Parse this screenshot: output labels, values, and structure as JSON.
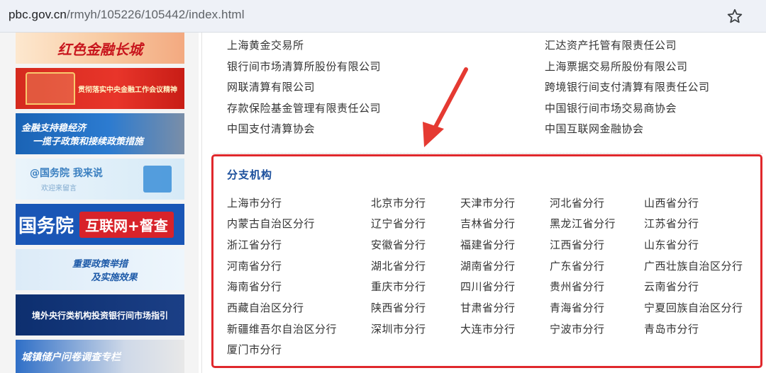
{
  "browser": {
    "url_domain": "pbc.gov.cn",
    "url_path": "/rmyh/105226/105442/index.html",
    "bookmark_icon": "star-icon"
  },
  "sidebar": {
    "banners": [
      {
        "text": "红色金融长城"
      },
      {
        "text": "贯彻落实中央金融工作会议精神"
      },
      {
        "line1": "金融支持稳经济",
        "line2": "一揽子政策和接续政策措施"
      },
      {
        "line1": "@国务院 我来说",
        "line2": "欢迎来留言"
      },
      {
        "left": "国务院",
        "right": "互联网+督查"
      },
      {
        "line1": "重要政策举措",
        "line2": "及实施效果"
      },
      {
        "text": "境外央行类机构投资银行间市场指引"
      },
      {
        "text": "城镇储户问卷调查专栏"
      }
    ]
  },
  "organizations": {
    "left": [
      "上海黄金交易所",
      "银行间市场清算所股份有限公司",
      "网联清算有限公司",
      "存款保险基金管理有限责任公司",
      "中国支付清算协会"
    ],
    "right": [
      "汇达资产托管有限责任公司",
      "上海票据交易所股份有限公司",
      "跨境银行间支付清算有限责任公司",
      "中国银行间市场交易商协会",
      "中国互联网金融协会"
    ]
  },
  "branches": {
    "title": "分支机构",
    "rows": [
      [
        "上海市分行",
        "北京市分行",
        "天津市分行",
        "河北省分行",
        "山西省分行"
      ],
      [
        "内蒙古自治区分行",
        "辽宁省分行",
        "吉林省分行",
        "黑龙江省分行",
        "江苏省分行"
      ],
      [
        "浙江省分行",
        "安徽省分行",
        "福建省分行",
        "江西省分行",
        "山东省分行"
      ],
      [
        "河南省分行",
        "湖北省分行",
        "湖南省分行",
        "广东省分行",
        "广西壮族自治区分行"
      ],
      [
        "海南省分行",
        "重庆市分行",
        "四川省分行",
        "贵州省分行",
        "云南省分行"
      ],
      [
        "西藏自治区分行",
        "陕西省分行",
        "甘肃省分行",
        "青海省分行",
        "宁夏回族自治区分行"
      ],
      [
        "新疆维吾尔自治区分行",
        "深圳市分行",
        "大连市分行",
        "宁波市分行",
        "青岛市分行"
      ],
      [
        "厦门市分行"
      ]
    ]
  },
  "colors": {
    "highlight_border": "#e0282c",
    "title_blue": "#1b4f9c",
    "link_text": "#333333"
  }
}
